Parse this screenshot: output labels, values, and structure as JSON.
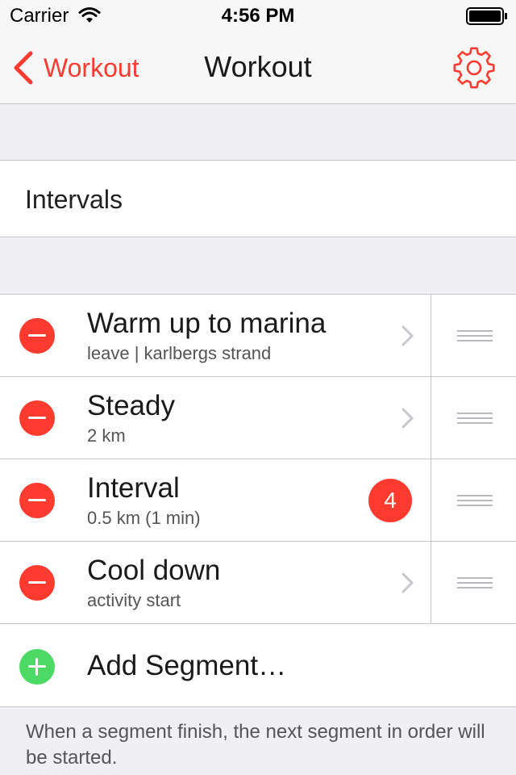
{
  "status_bar": {
    "carrier": "Carrier",
    "time": "4:56 PM",
    "wifi_icon": "wifi-icon",
    "battery_icon": "battery-full-icon"
  },
  "nav": {
    "back_label": "Workout",
    "back_icon": "chevron-left-icon",
    "title": "Workout",
    "settings_icon": "gear-icon"
  },
  "workout": {
    "name": "Intervals"
  },
  "segments": [
    {
      "title": "Warm up to marina",
      "subtitle": "leave | karlbergs strand",
      "accessory": "chevron-right-icon"
    },
    {
      "title": "Steady",
      "subtitle": "2 km",
      "accessory": "chevron-right-icon"
    },
    {
      "title": "Interval",
      "subtitle": "0.5 km (1 min)",
      "badge": "4"
    },
    {
      "title": "Cool down",
      "subtitle": "activity start",
      "accessory": "chevron-right-icon"
    }
  ],
  "add_segment": {
    "label": "Add Segment…",
    "icon": "plus-circle-icon"
  },
  "footer": "When a segment finish, the next segment in order will be started.",
  "colors": {
    "accent": "#ff3b30",
    "add_green": "#4cd964",
    "background": "#efeff4",
    "separator": "#c8c7cc"
  }
}
